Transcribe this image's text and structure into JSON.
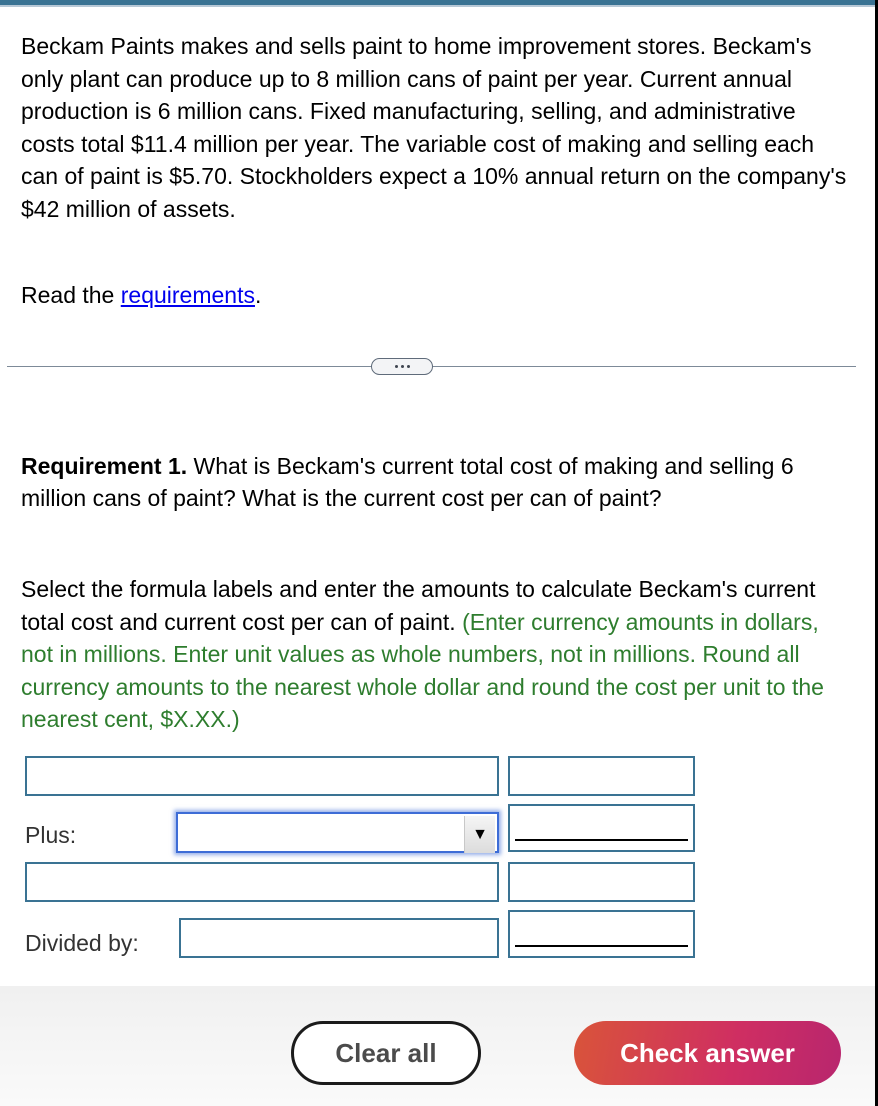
{
  "problem": {
    "text": "Beckam Paints makes and sells paint to home improvement stores. Beckam's only plant can produce up to 8 million cans of paint per year. Current annual production is 6 million cans. Fixed manufacturing, selling, and administrative costs total $11.4 million per year. The variable cost of making and selling each can of paint is $5.70. Stockholders expect a 10% annual return on the company's $42 million of assets.",
    "read_prefix": "Read the ",
    "read_link": "requirements",
    "read_suffix": "."
  },
  "divider": {
    "icon": "more-dots-icon"
  },
  "requirement": {
    "label": "Requirement 1.",
    "question": " What is Beckam's current total cost of making and selling 6 million cans of paint? What is the current cost per can of paint?"
  },
  "instructions": {
    "text": "Select the formula labels and enter the amounts to calculate Beckam's current total cost and current cost per can of paint. ",
    "note": "(Enter currency amounts in dollars, not in millions. Enter unit values as whole numbers, not in millions. Round all currency amounts to the nearest whole dollar and round the cost per unit to the nearest cent, $X.XX.)"
  },
  "form": {
    "rows": [
      {
        "label": "",
        "select_value": "",
        "amount": ""
      },
      {
        "label": "Plus:",
        "select_value": "",
        "amount": ""
      },
      {
        "label": "",
        "select_value": "",
        "amount": ""
      },
      {
        "label": "Divided by:",
        "select_value": "",
        "amount": ""
      }
    ],
    "dropdown_arrow": "▼"
  },
  "footer": {
    "clear_label": "Clear all",
    "check_label": "Check answer"
  }
}
